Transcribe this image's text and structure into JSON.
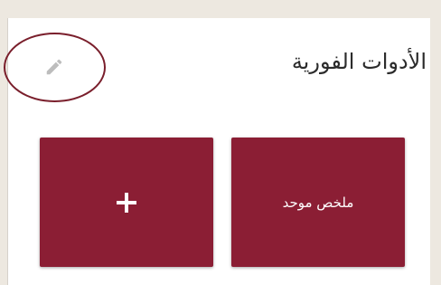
{
  "header": {
    "title": "الأدوات الفورية",
    "edit_icon": "pencil-icon"
  },
  "tiles": [
    {
      "label": "ملخص موحد"
    },
    {
      "icon": "plus-icon"
    }
  ],
  "colors": {
    "tile_background": "#8b1e34",
    "highlight_circle": "#7a1f2c",
    "icon_gray": "#bdbdbd"
  }
}
